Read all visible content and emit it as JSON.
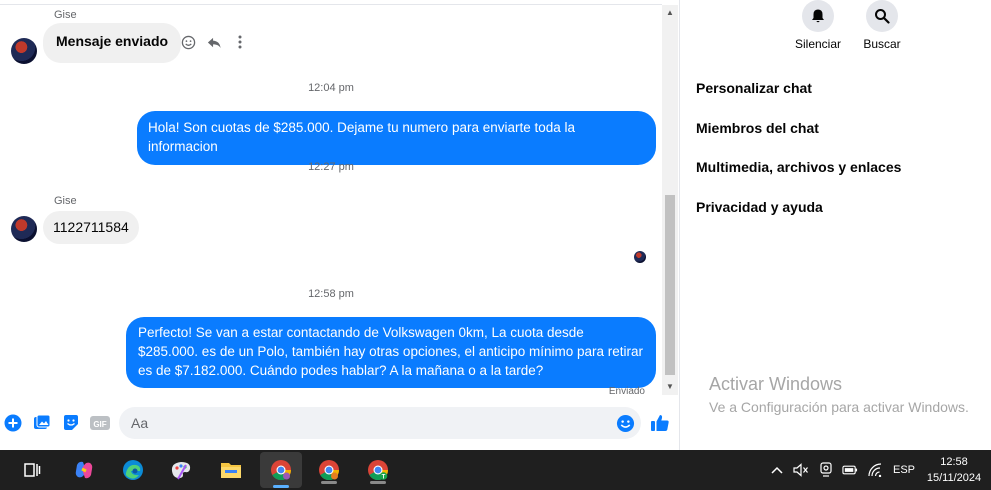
{
  "chat": {
    "messages": [
      {
        "sender": "Gise",
        "text": "Mensaje enviado"
      },
      {
        "time": "12:04 pm"
      },
      {
        "text": "Hola! Son cuotas de $285.000. Dejame tu numero para enviarte toda la informacion"
      },
      {
        "time": "12:27 pm"
      },
      {
        "sender": "Gise",
        "text": "1122711584"
      },
      {
        "time": "12:58 pm"
      },
      {
        "text": "Perfecto!  Se van a estar contactando de Volkswagen 0km, La cuota desde $285.000. es de un Polo, también hay otras opciones, el anticipo mínimo para retirar es de $7.182.000. Cuándo podes hablar? A la mañana o a la tarde?"
      }
    ],
    "status": "Enviado",
    "composer_placeholder": "Aa"
  },
  "panel": {
    "buttons": [
      {
        "label": "Silenciar",
        "icon": "bell-icon"
      },
      {
        "label": "Buscar",
        "icon": "search-icon"
      }
    ],
    "menu": [
      "Personalizar chat",
      "Miembros del chat",
      "Multimedia, archivos y enlaces",
      "Privacidad y ayuda"
    ]
  },
  "watermark": {
    "title": "Activar Windows",
    "subtitle": "Ve a Configuración para activar Windows."
  },
  "taskbar": {
    "lang": "ESP",
    "time": "12:58",
    "date": "15/11/2024"
  },
  "colors": {
    "accent": "#0a7cff",
    "incoming_bubble": "#f0f0f0",
    "taskbar": "#1f1f1f"
  }
}
